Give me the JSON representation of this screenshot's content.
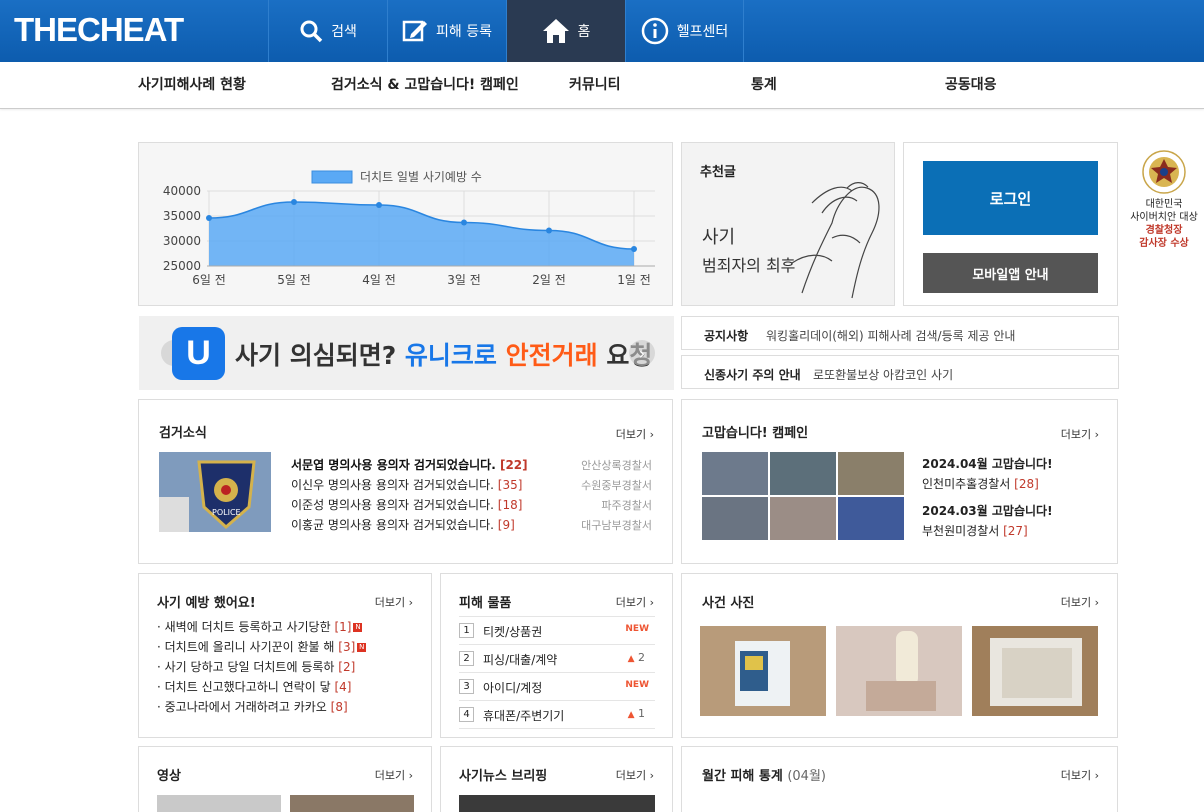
{
  "header": {
    "logo_bold": "THECHEAT",
    "nav": [
      {
        "label": "검색",
        "icon": "search-icon"
      },
      {
        "label": "피해 등록",
        "icon": "edit-icon"
      },
      {
        "label": "홈",
        "icon": "home-icon"
      },
      {
        "label": "헬프센터",
        "icon": "info-icon"
      }
    ]
  },
  "subnav": [
    "사기피해사례 현황",
    "검거소식 & 고맙습니다! 캠페인",
    "커뮤니티",
    "통계",
    "공동대응"
  ],
  "chart_data": {
    "type": "area",
    "legend": "더치트 일별 사기예방 수",
    "categories": [
      "6일 전",
      "5일 전",
      "4일 전",
      "3일 전",
      "2일 전",
      "1일 전"
    ],
    "series": [
      {
        "name": "더치트 일별 사기예방 수",
        "values": [
          34600,
          37800,
          37200,
          33700,
          32100,
          28400
        ]
      }
    ],
    "yticks": [
      "40000",
      "35000",
      "30000",
      "25000"
    ],
    "ylim": [
      25000,
      40000
    ],
    "color": "#5aa9f5"
  },
  "recommend": {
    "title": "추천글",
    "caption": "사기 범죄자의 최후"
  },
  "login": {
    "login_label": "로그인",
    "mobile_label": "모바일앱 안내"
  },
  "award": {
    "line1": "대한민국",
    "line2": "사이버치안 대상",
    "line3": "경찰청장",
    "line4": "감사장 수상"
  },
  "banner": {
    "text1": "사기 의심되면? ",
    "text2": "유니크로 ",
    "text3": "안전거래",
    "text4": " 요청",
    "logo": "U"
  },
  "notice": {
    "label": "공지사항",
    "value": "워킹홀리데이(해외) 피해사례 검색/등록 제공 안내"
  },
  "notice2": {
    "label": "신종사기 주의 안내",
    "value": "로또환불보상 아캄코인 사기"
  },
  "more_label": "더보기",
  "arrest": {
    "title": "검거소식",
    "rows": [
      {
        "text": "서문엽 명의사용 용의자 검거되었습니다.",
        "count": "[22]",
        "org": "안산상록경찰서"
      },
      {
        "text": "이신우 명의사용 용의자 검거되었습니다.",
        "count": "[35]",
        "org": "수원중부경찰서"
      },
      {
        "text": "이준성 명의사용 용의자 검거되었습니다.",
        "count": "[18]",
        "org": "파주경찰서"
      },
      {
        "text": "이홍균 명의사용 용의자 검거되었습니다.",
        "count": "[9]",
        "org": "대구남부경찰서"
      }
    ]
  },
  "thanks": {
    "title": "고맙습니다! 캠페인",
    "entries": [
      {
        "month": "2024.04월 고맙습니다!",
        "org": "인천미추홀경찰서",
        "count": "[28]"
      },
      {
        "month": "2024.03월 고맙습니다!",
        "org": "부천원미경찰서",
        "count": "[27]"
      }
    ]
  },
  "prevent": {
    "title": "사기 예방 했어요!",
    "items": [
      {
        "text": "· 새벽에 더치트 등록하고 사기당한",
        "count": "[1]",
        "new": true
      },
      {
        "text": "· 더치트에 올리니 사기꾼이 환불 해",
        "count": "[3]",
        "new": true
      },
      {
        "text": "· 사기 당하고 당일 더치트에 등록하",
        "count": "[2]",
        "new": false
      },
      {
        "text": "· 더치트 신고했다고하니 연락이 닿",
        "count": "[4]",
        "new": false
      },
      {
        "text": "· 중고나라에서 거래하려고 카카오",
        "count": "[8]",
        "new": false
      }
    ]
  },
  "items": {
    "title": "피해 물품",
    "rows": [
      {
        "num": "1",
        "name": "티켓/상품권",
        "tag": "NEW",
        "rise": ""
      },
      {
        "num": "2",
        "name": "피싱/대출/계약",
        "tag": "",
        "rise": "2"
      },
      {
        "num": "3",
        "name": "아이디/계정",
        "tag": "NEW",
        "rise": ""
      },
      {
        "num": "4",
        "name": "휴대폰/주변기기",
        "tag": "",
        "rise": "1"
      }
    ]
  },
  "photos": {
    "title": "사건 사진"
  },
  "video": {
    "title": "영상"
  },
  "news": {
    "title": "사기뉴스 브리핑"
  },
  "stats": {
    "title": "월간 피해 통계",
    "month": "(04월)"
  }
}
